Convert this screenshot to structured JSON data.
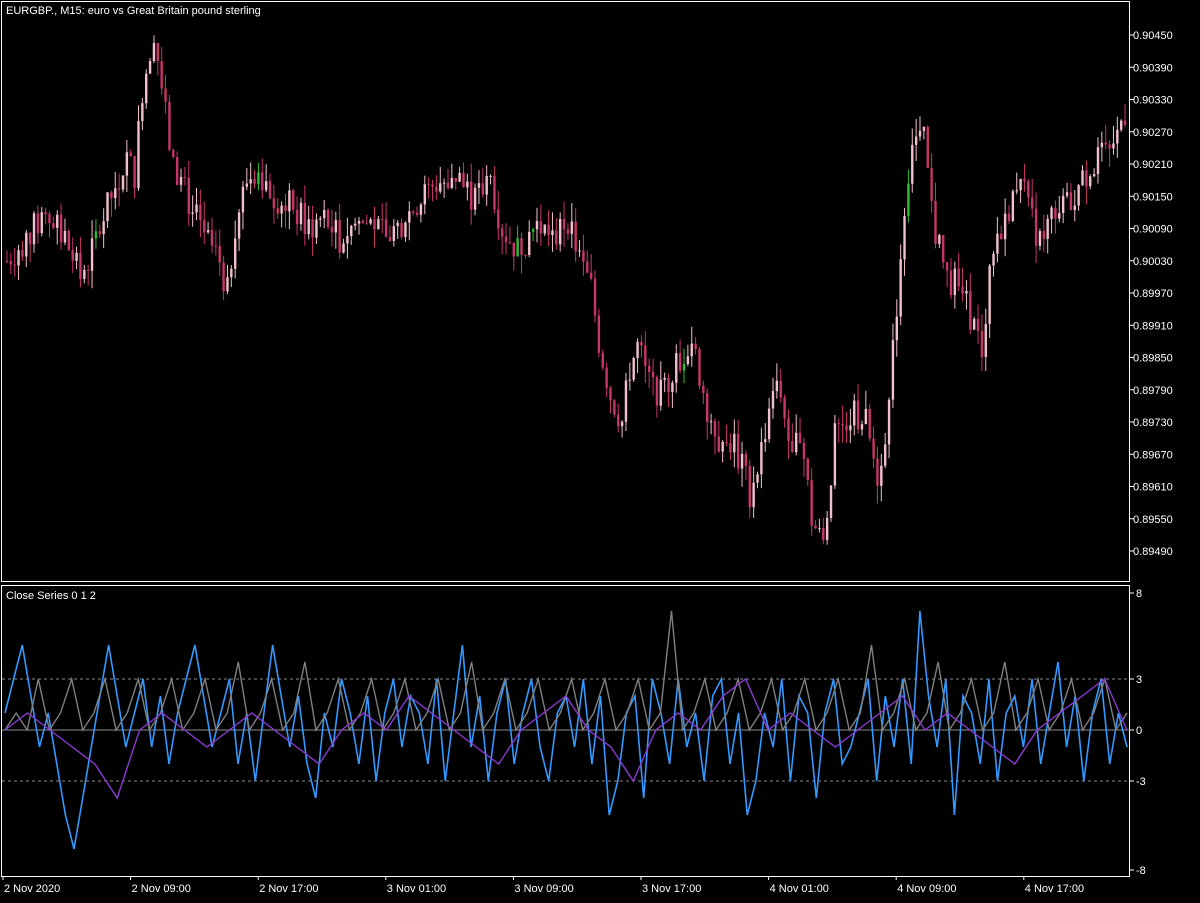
{
  "main_chart": {
    "symbol_label": "EURGBP., M15:  euro vs Great Britain pound sterling",
    "price_labels": [
      "0.90450",
      "0.90390",
      "0.90330",
      "0.90270",
      "0.90210",
      "0.90150",
      "0.90090",
      "0.90030",
      "0.89970",
      "0.89910",
      "0.89850",
      "0.89790",
      "0.89730",
      "0.89670",
      "0.89610",
      "0.89550",
      "0.89490"
    ],
    "time_labels": [
      "2 Nov 2020",
      "2 Nov 09:00",
      "2 Nov 17:00",
      "3 Nov 01:00",
      "3 Nov 09:00",
      "3 Nov 17:00",
      "4 Nov 01:00",
      "4 Nov 09:00",
      "4 Nov 17:00"
    ]
  },
  "indicator": {
    "label": "Close Series 0 1 2",
    "scale_labels": [
      "8",
      "3",
      "0",
      "-3",
      "-8"
    ]
  },
  "colors": {
    "background": "#000000",
    "frame": "#ffffff",
    "bear_candle": "#c8356a",
    "bull_candle": "#f2c0cc",
    "bull_candle_alt": "#2fbf2f",
    "series_blue": "#3399ff",
    "series_gray": "#808080",
    "series_purple": "#8a3ad1",
    "level_line": "#8c8c8c"
  },
  "chart_data": [
    {
      "type": "candlestick",
      "title": "EURGBP., M15:  euro vs Great Britain pound sterling",
      "timeframe": "M15",
      "x_tick_labels": [
        "2 Nov 2020",
        "2 Nov 09:00",
        "2 Nov 17:00",
        "3 Nov 01:00",
        "3 Nov 09:00",
        "3 Nov 17:00",
        "4 Nov 01:00",
        "4 Nov 09:00",
        "4 Nov 17:00"
      ],
      "ylim": [
        0.8945,
        0.9048
      ],
      "y_tick_labels": [
        "0.90450",
        "0.90390",
        "0.90330",
        "0.90270",
        "0.90210",
        "0.90150",
        "0.90090",
        "0.90030",
        "0.89970",
        "0.89910",
        "0.89850",
        "0.89790",
        "0.89730",
        "0.89670",
        "0.89610",
        "0.89550",
        "0.89490"
      ],
      "close_path": [
        [
          0,
          0.9003
        ],
        [
          6,
          0.9008
        ],
        [
          10,
          0.9012
        ],
        [
          15,
          0.9007
        ],
        [
          19,
          0.9
        ],
        [
          22,
          0.9005
        ],
        [
          27,
          0.9015
        ],
        [
          31,
          0.9022
        ],
        [
          33,
          0.9019
        ],
        [
          35,
          0.9035
        ],
        [
          38,
          0.9046
        ],
        [
          41,
          0.903
        ],
        [
          43,
          0.902
        ],
        [
          45,
          0.9018
        ],
        [
          48,
          0.9012
        ],
        [
          51,
          0.9008
        ],
        [
          55,
          0.9003
        ],
        [
          57,
          0.8997
        ],
        [
          59,
          0.901
        ],
        [
          62,
          0.9018
        ],
        [
          65,
          0.902
        ],
        [
          69,
          0.9015
        ],
        [
          74,
          0.9013
        ],
        [
          78,
          0.9009
        ],
        [
          82,
          0.9011
        ],
        [
          86,
          0.9007
        ],
        [
          90,
          0.901
        ],
        [
          94,
          0.901
        ],
        [
          98,
          0.9007
        ],
        [
          104,
          0.9012
        ],
        [
          110,
          0.9017
        ],
        [
          116,
          0.9019
        ],
        [
          121,
          0.9014
        ],
        [
          125,
          0.9018
        ],
        [
          128,
          0.9009
        ],
        [
          132,
          0.9005
        ],
        [
          137,
          0.901
        ],
        [
          141,
          0.9007
        ],
        [
          145,
          0.9011
        ],
        [
          148,
          0.9003
        ],
        [
          151,
          0.8998
        ],
        [
          153,
          0.8988
        ],
        [
          156,
          0.8978
        ],
        [
          159,
          0.8973
        ],
        [
          161,
          0.8983
        ],
        [
          163,
          0.8987
        ],
        [
          166,
          0.8981
        ],
        [
          169,
          0.8978
        ],
        [
          173,
          0.8984
        ],
        [
          177,
          0.8988
        ],
        [
          181,
          0.8976
        ],
        [
          184,
          0.897
        ],
        [
          188,
          0.8969
        ],
        [
          192,
          0.896
        ],
        [
          195,
          0.8968
        ],
        [
          198,
          0.898
        ],
        [
          200,
          0.8978
        ],
        [
          203,
          0.8966
        ],
        [
          205,
          0.8972
        ],
        [
          208,
          0.8955
        ],
        [
          211,
          0.895
        ],
        [
          214,
          0.897
        ],
        [
          218,
          0.8975
        ],
        [
          222,
          0.8973
        ],
        [
          225,
          0.8963
        ],
        [
          228,
          0.8976
        ],
        [
          230,
          0.8995
        ],
        [
          232,
          0.9013
        ],
        [
          234,
          0.9026
        ],
        [
          237,
          0.9025
        ],
        [
          240,
          0.9008
        ],
        [
          243,
          0.9
        ],
        [
          246,
          0.8998
        ],
        [
          249,
          0.8993
        ],
        [
          252,
          0.8986
        ],
        [
          255,
          0.9006
        ],
        [
          259,
          0.9013
        ],
        [
          262,
          0.902
        ],
        [
          264,
          0.9012
        ],
        [
          267,
          0.9007
        ],
        [
          271,
          0.9013
        ],
        [
          275,
          0.9014
        ],
        [
          279,
          0.9019
        ],
        [
          282,
          0.9022
        ],
        [
          285,
          0.9023
        ],
        [
          289,
          0.9031
        ]
      ]
    },
    {
      "type": "line",
      "title": "Close Series 0 1 2",
      "ylim": [
        -8,
        8
      ],
      "y_tick_labels": [
        "8",
        "3",
        "0",
        "-3",
        "-8"
      ],
      "levels": [
        3,
        0,
        -3
      ],
      "series": [
        {
          "color": "#3399ff",
          "values": [
            1,
            3,
            5,
            2,
            -1,
            1,
            -2,
            -5,
            -7,
            -4,
            -1,
            2,
            5,
            2,
            -1,
            1,
            3,
            -1,
            2,
            -2,
            1,
            3,
            5,
            2,
            -1,
            1,
            3,
            -2,
            1,
            -3,
            1,
            5,
            2,
            -1,
            2,
            -2,
            -4,
            1,
            -1,
            3,
            1,
            -2,
            2,
            -3,
            1,
            3,
            -1,
            2,
            1,
            -2,
            3,
            -3,
            1,
            5,
            -1,
            2,
            -3,
            1,
            3,
            -2,
            1,
            3,
            -1,
            -3,
            1,
            2,
            -1,
            3,
            -2,
            2,
            -5,
            -3,
            1,
            2,
            -4,
            3,
            1,
            -2,
            3,
            -1,
            1,
            -3,
            2,
            3,
            -2,
            1,
            -5,
            -3,
            1,
            -1,
            3,
            -3,
            2,
            1,
            -4,
            1,
            3,
            -2,
            -1,
            1,
            3,
            -3,
            2,
            -1,
            3,
            -2,
            7,
            2,
            -1,
            3,
            -5,
            2,
            1,
            -2,
            3,
            -3,
            1,
            2,
            -1,
            3,
            -2,
            1,
            4,
            -1,
            2,
            -3,
            1,
            3,
            -2,
            1,
            -1
          ]
        },
        {
          "color": "#808080",
          "values": [
            0,
            1,
            0,
            3,
            0,
            1,
            3,
            0,
            1,
            3,
            0,
            1,
            3,
            0,
            1,
            3,
            0,
            1,
            3,
            0,
            1,
            4,
            0,
            1,
            3,
            0,
            1,
            4,
            0,
            1,
            3,
            0,
            1,
            3,
            0,
            1,
            3,
            0,
            1,
            3,
            0,
            1,
            4,
            0,
            1,
            3,
            0,
            1,
            3,
            0,
            1,
            3,
            0,
            1,
            3,
            0,
            1,
            3,
            0,
            1,
            7,
            0,
            1,
            3,
            0,
            1,
            3,
            0,
            1,
            3,
            0,
            1,
            3,
            0,
            1,
            3,
            0,
            1,
            5,
            0,
            1,
            3,
            0,
            1,
            4,
            0,
            1,
            3,
            0,
            1,
            4,
            0,
            1,
            3,
            0,
            1,
            3,
            0,
            1,
            3,
            0,
            1
          ]
        },
        {
          "color": "#8a3ad1",
          "values": [
            0,
            1,
            0,
            -1,
            -2,
            -4,
            0,
            1,
            0,
            -1,
            0,
            1,
            0,
            -1,
            -2,
            0,
            1,
            0,
            2,
            1,
            0,
            -1,
            -2,
            0,
            1,
            2,
            0,
            -1,
            -3,
            0,
            1,
            0,
            2,
            3,
            0,
            1,
            0,
            -1,
            0,
            1,
            2,
            0,
            1,
            0,
            -1,
            -2,
            0,
            1,
            2,
            3,
            0
          ]
        }
      ]
    }
  ]
}
